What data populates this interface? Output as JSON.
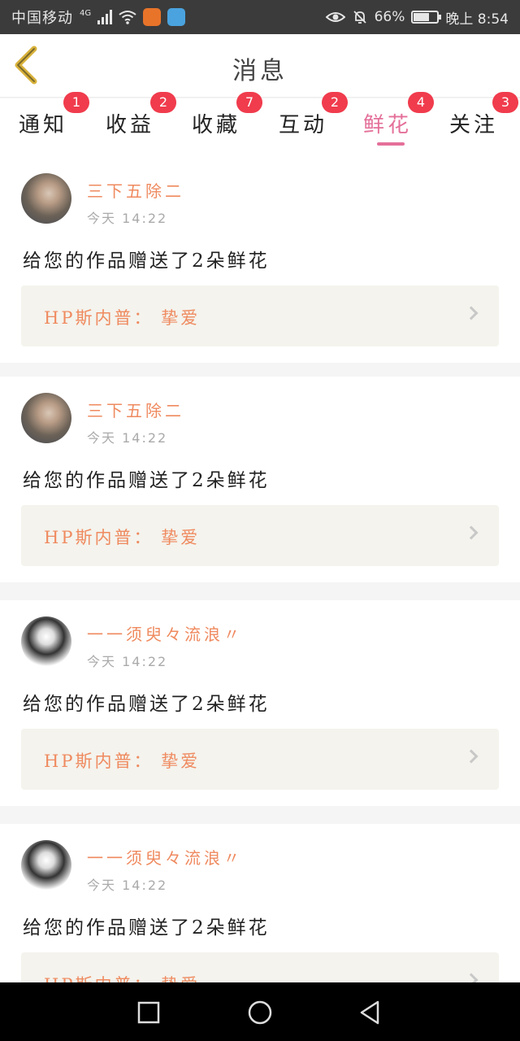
{
  "status_bar": {
    "carrier": "中国移动",
    "network": "4G",
    "battery_text": "66%",
    "time": "晚上 8:54",
    "battery_level": 0.66
  },
  "header": {
    "title": "消息"
  },
  "tabs": [
    {
      "label": "通知",
      "badge": "1"
    },
    {
      "label": "收益",
      "badge": "2"
    },
    {
      "label": "收藏",
      "badge": "7"
    },
    {
      "label": "互动",
      "badge": "2"
    },
    {
      "label": "鲜花",
      "badge": "4",
      "active": true
    },
    {
      "label": "关注",
      "badge": "3"
    }
  ],
  "messages": [
    {
      "username": "三下五除二",
      "time": "今天 14:22",
      "text": "给您的作品赠送了2朵鲜花",
      "work": "HP斯内普： 挚爱"
    },
    {
      "username": "三下五除二",
      "time": "今天 14:22",
      "text": "给您的作品赠送了2朵鲜花",
      "work": "HP斯内普： 挚爱"
    },
    {
      "username": "一一须臾々流浪〃",
      "time": "今天 14:22",
      "text": "给您的作品赠送了2朵鲜花",
      "work": "HP斯内普： 挚爱"
    },
    {
      "username": "一一须臾々流浪〃",
      "time": "今天 14:22",
      "text": "给您的作品赠送了2朵鲜花",
      "work": "HP斯内普： 挚爱"
    }
  ],
  "colors": {
    "accent": "#e46f99",
    "name_color": "#ef8a5f",
    "badge": "#f03c4d",
    "back_arrow": "#d9b23b"
  }
}
